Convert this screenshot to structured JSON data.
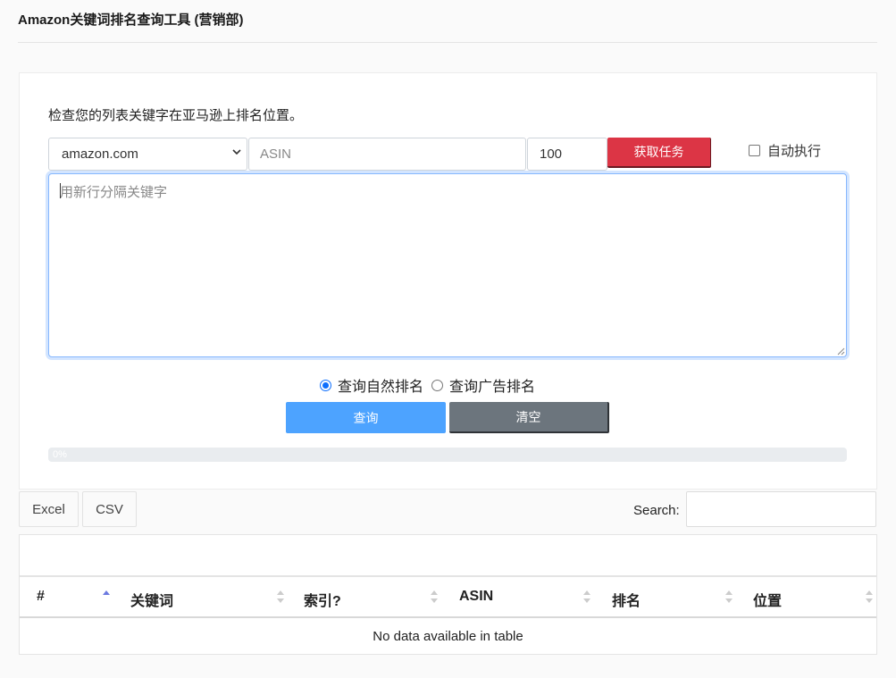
{
  "header": {
    "title": "Amazon关键词排名查询工具 (营销部)"
  },
  "form": {
    "description": "检查您的列表关键字在亚马逊上排名位置。",
    "marketplace": {
      "selected": "amazon.com"
    },
    "asin": {
      "placeholder": "ASIN",
      "value": ""
    },
    "count": {
      "value": "100"
    },
    "task_button": "获取任务",
    "auto_run": {
      "label": "自动执行",
      "checked": false
    },
    "keywords": {
      "placeholder": "用新行分隔关键字",
      "value": ""
    },
    "rank_type": {
      "options": [
        {
          "label": "查询自然排名",
          "selected": true
        },
        {
          "label": "查询广告排名",
          "selected": false
        }
      ]
    },
    "query_button": "查询",
    "clear_button": "清空",
    "progress": {
      "label": "0%",
      "value": 0
    }
  },
  "table_controls": {
    "export": [
      "Excel",
      "CSV"
    ],
    "search_label": "Search:",
    "search_value": ""
  },
  "table": {
    "columns": [
      "#",
      "关键词",
      "索引?",
      "ASIN",
      "排名",
      "位置"
    ],
    "empty_message": "No data available in table"
  },
  "colors": {
    "task_button": "#dc3545",
    "query_button": "#4da3ff",
    "clear_button": "#6c757d",
    "focus": "#86b7fe",
    "radio": "#0d6efd"
  },
  "icons": {
    "select": "chevron-down-icon",
    "sort_active": "sort-asc-icon",
    "sort": "sort-both-icon",
    "resize": "resize-grip-icon"
  }
}
